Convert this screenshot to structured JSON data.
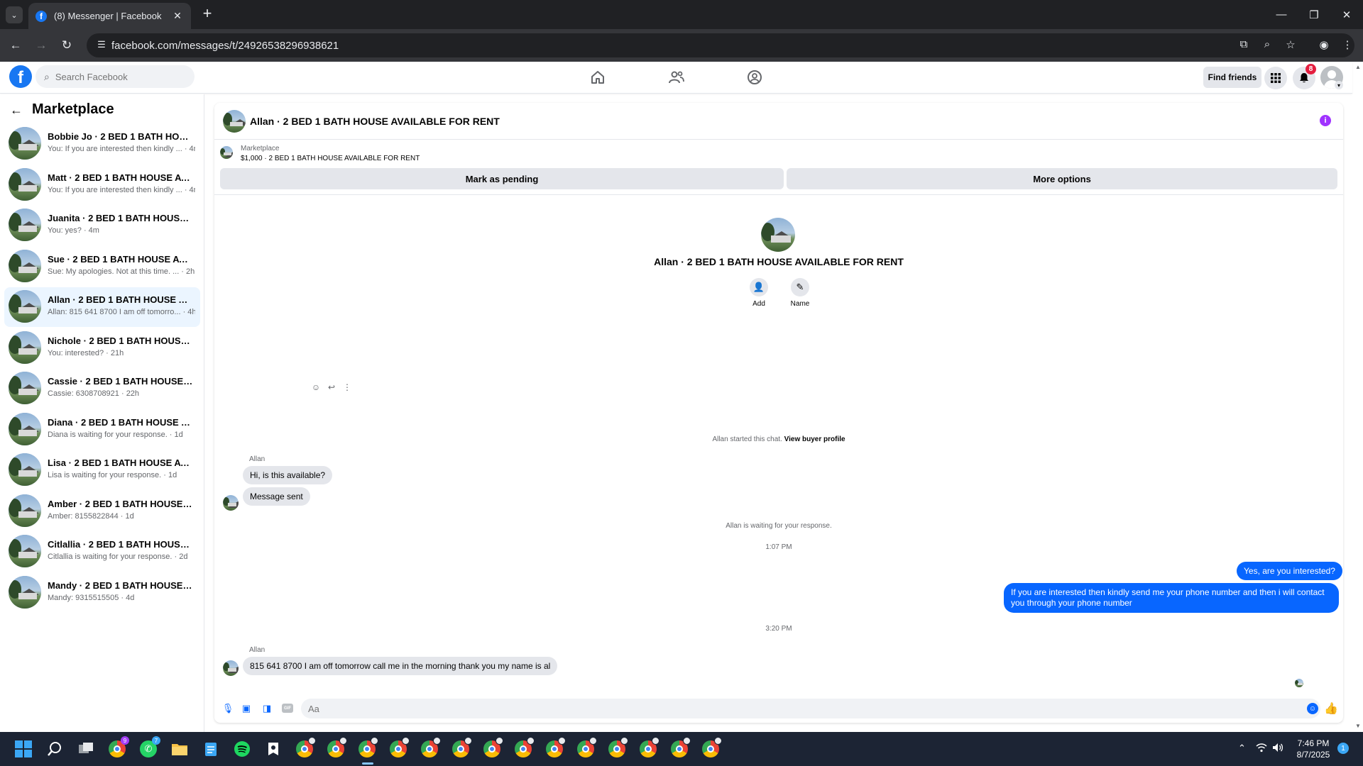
{
  "browser": {
    "tab_title": "(8) Messenger | Facebook",
    "tab_close": "✕",
    "new_tab": "+",
    "url": "facebook.com/messages/t/24926538296938621"
  },
  "facebook": {
    "logo": "f",
    "search_placeholder": "Search Facebook",
    "find_friends_label": "Find friends",
    "notification_count": "8",
    "nav_icons": [
      "home-icon",
      "friends-icon",
      "groups-icon"
    ]
  },
  "sidebar": {
    "title": "Marketplace",
    "conversations": [
      {
        "name": "Bobbie Jo · 2 BED 1 BATH HOUSE AVAILABLE FOR RENT",
        "preview": "You: If you are interested then kindly ... · 4m"
      },
      {
        "name": "Matt · 2 BED 1 BATH HOUSE AVAILABLE FOR RENT",
        "preview": "You: If you are interested then kindly ... · 4m"
      },
      {
        "name": "Juanita · 2 BED 1 BATH HOUSE AVAILABLE FOR RENT",
        "preview": "You: yes? · 4m"
      },
      {
        "name": "Sue · 2 BED 1 BATH HOUSE AVAILABLE FOR RENT",
        "preview": "Sue: My apologies. Not at this time. ... · 2h"
      },
      {
        "name": "Allan · 2 BED 1 BATH HOUSE AVAILABLE FOR RENT",
        "preview": "Allan: 815 641 8700 I am off tomorro... · 4h"
      },
      {
        "name": "Nichole · 2 BED 1 BATH HOUSE AVAILABLE FOR RENT",
        "preview": "You: interested? · 21h"
      },
      {
        "name": "Cassie · 2 BED 1 BATH HOUSE AVAILABLE FOR RENT",
        "preview": "Cassie: 6308708921 · 22h"
      },
      {
        "name": "Diana · 2 BED 1 BATH HOUSE AVAILABLE FOR RENT",
        "preview": "Diana is waiting for your response. · 1d"
      },
      {
        "name": "Lisa · 2 BED 1 BATH HOUSE AVAILABLE FOR RENT",
        "preview": "Lisa is waiting for your response. · 1d"
      },
      {
        "name": "Amber · 2 BED 1 BATH HOUSE AVAILABLE FOR RENT",
        "preview": "Amber: 8155822844 · 1d"
      },
      {
        "name": "Citlallia · 2 BED 1 BATH HOUSE AVAILABLE FOR RENT",
        "preview": "Citlallia is waiting for your response. · 2d"
      },
      {
        "name": "Mandy · 2 BED 1 BATH HOUSE AVAILABLE FOR RENT",
        "preview": "Mandy: 9315515505 · 4d"
      }
    ]
  },
  "chat": {
    "title": "Allan · 2 BED 1 BATH HOUSE AVAILABLE FOR RENT",
    "info_glyph": "i",
    "marketplace_label": "Marketplace",
    "listing": "$1,000 · 2 BED 1 BATH HOUSE AVAILABLE FOR RENT",
    "mark_pending_label": "Mark as pending",
    "more_options_label": "More options",
    "intro_title": "Allan · 2 BED 1 BATH HOUSE AVAILABLE FOR RENT",
    "add_label": "Add",
    "name_label": "Name",
    "started_text": "Allan started this chat.",
    "view_buyer_profile": "View buyer profile",
    "sender_1": "Allan",
    "msg_1": "Hi, is this available?",
    "msg_2": "Message sent",
    "waiting_text": "Allan is waiting for your response.",
    "time_1": "1:07 PM",
    "out_1": "Yes, are you interested?",
    "out_2": "If you are interested then kindly send me your phone number and then i will contact you through your phone number",
    "time_2": "3:20 PM",
    "sender_2": "Allan",
    "msg_3": "815 641 8700  I am off tomorrow  call me  in the morning  thank you my name is al",
    "composer_placeholder": "Aa"
  },
  "taskbar": {
    "time": "7:46 PM",
    "date": "8/7/2025",
    "notification_count": "1",
    "chrome_badge": "9",
    "whatsapp_badge": "7"
  },
  "colors": {
    "facebook_blue": "#1877f2",
    "messenger_blue": "#0866ff",
    "active_conversation": "#ebf5ff",
    "button_gray": "#e4e6eb",
    "notification_red": "#e41e3f"
  }
}
